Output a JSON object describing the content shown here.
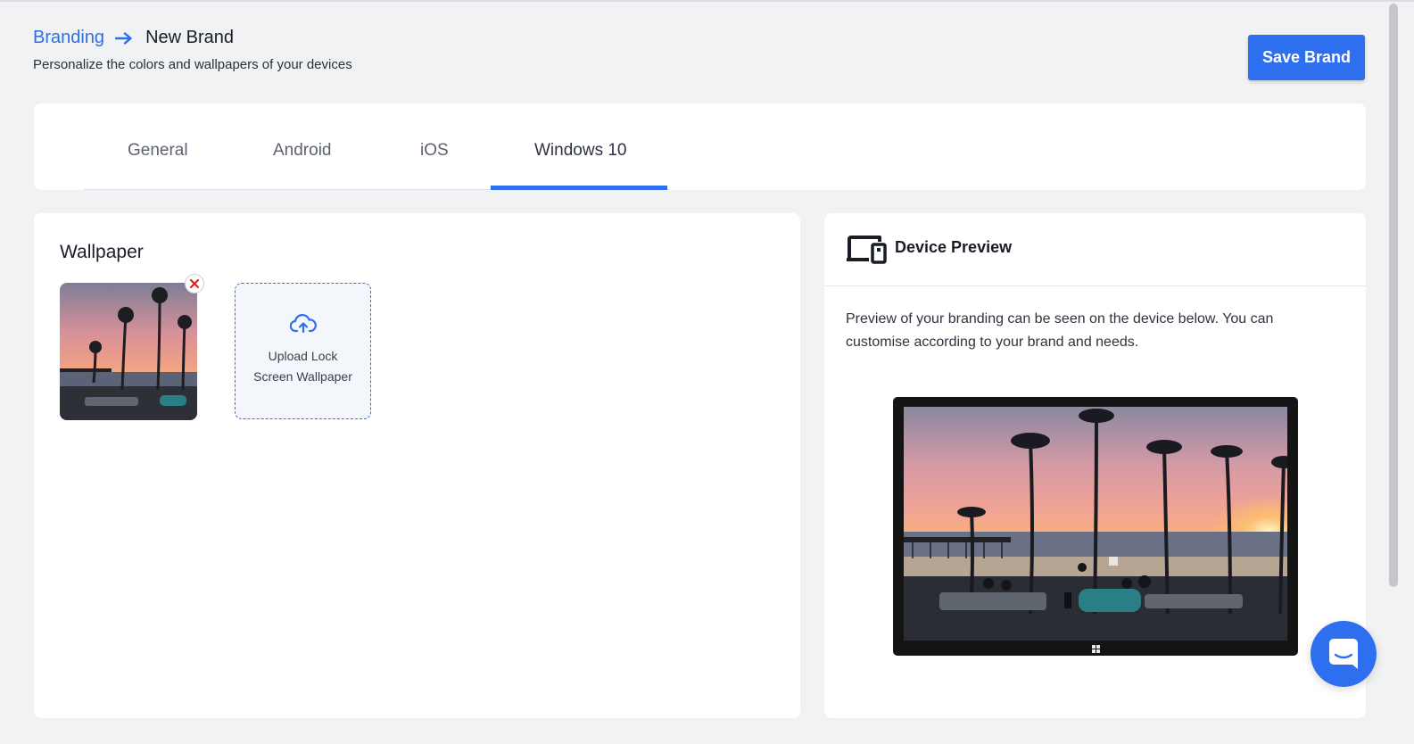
{
  "breadcrumb": {
    "parent": "Branding",
    "current": "New Brand"
  },
  "subtitle": "Personalize the colors and wallpapers of your devices",
  "save_button": "Save Brand",
  "tabs": [
    {
      "label": "General"
    },
    {
      "label": "Android"
    },
    {
      "label": "iOS"
    },
    {
      "label": "Windows 10",
      "active": true
    }
  ],
  "wallpaper": {
    "title": "Wallpaper",
    "upload_label": "Upload Lock Screen Wallpaper",
    "upload_line1": "Upload Lock",
    "upload_line2": "Screen Wallpaper"
  },
  "preview": {
    "title": "Device Preview",
    "description": "Preview of your branding can be seen on the device below. You can customise according to your brand and needs."
  },
  "icons": [
    "arrow-right-icon",
    "remove-icon",
    "cloud-upload-icon",
    "devices-icon",
    "windows-logo-icon",
    "chat-icon"
  ],
  "colors": {
    "accent": "#2e6ff0",
    "background": "#f1f2f4",
    "remove": "#e02020"
  }
}
